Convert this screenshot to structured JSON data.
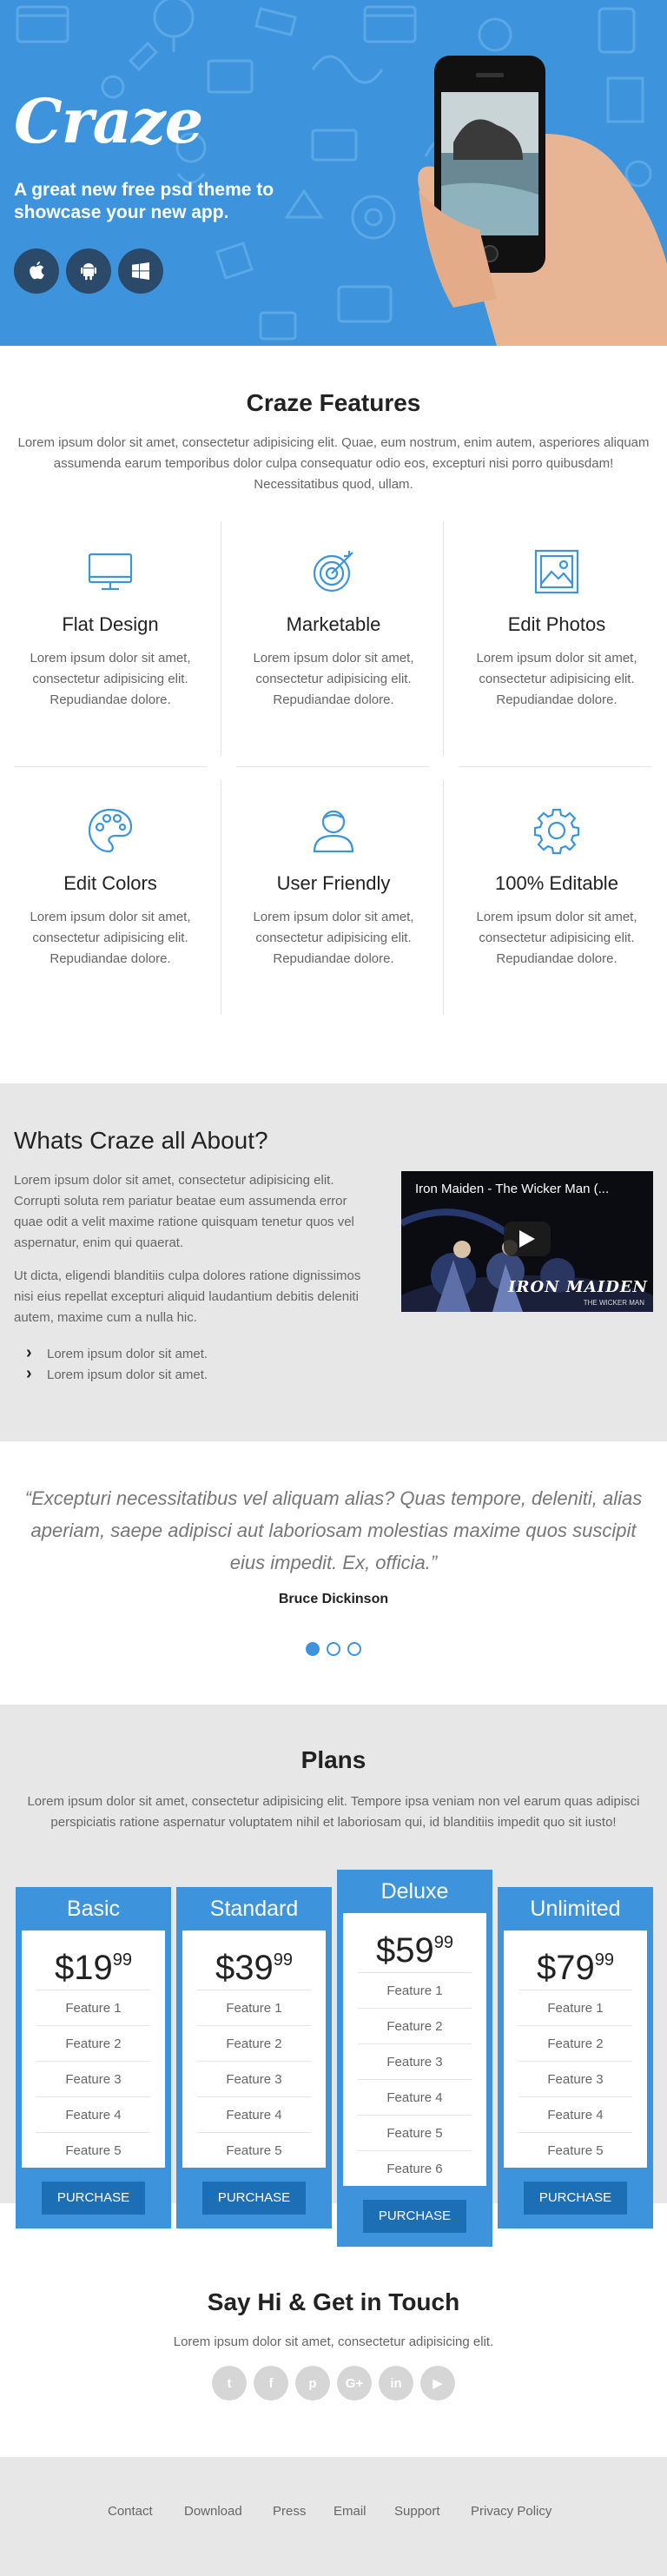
{
  "hero": {
    "logo": "Craze",
    "tagline": "A great new free psd theme to showcase your new app.",
    "store_buttons": [
      {
        "icon": "apple-icon"
      },
      {
        "icon": "android-icon"
      },
      {
        "icon": "windows-icon"
      }
    ]
  },
  "features": {
    "title": "Craze Features",
    "lead": "Lorem ipsum dolor sit amet, consectetur adipisicing elit. Quae, eum nostrum, enim autem, asperiores aliquam assumenda earum temporibus dolor culpa consequatur odio eos, excepturi nisi porro quibusdam! Necessitatibus quod, ullam.",
    "items": [
      {
        "icon": "monitor-icon",
        "title": "Flat Design",
        "text": "Lorem ipsum dolor sit amet, consectetur adipisicing elit. Repudiandae dolore."
      },
      {
        "icon": "target-icon",
        "title": "Marketable",
        "text": "Lorem ipsum dolor sit amet, consectetur adipisicing elit. Repudiandae dolore."
      },
      {
        "icon": "image-icon",
        "title": "Edit Photos",
        "text": "Lorem ipsum dolor sit amet, consectetur adipisicing elit. Repudiandae dolore."
      },
      {
        "icon": "palette-icon",
        "title": "Edit Colors",
        "text": "Lorem ipsum dolor sit amet, consectetur adipisicing elit. Repudiandae dolore."
      },
      {
        "icon": "user-icon",
        "title": "User Friendly",
        "text": "Lorem ipsum dolor sit amet, consectetur adipisicing elit. Repudiandae dolore."
      },
      {
        "icon": "gear-icon",
        "title": "100% Editable",
        "text": "Lorem ipsum dolor sit amet, consectetur adipisicing elit. Repudiandae dolore."
      }
    ]
  },
  "about": {
    "title": "Whats Craze all About?",
    "p1": "Lorem ipsum dolor sit amet, consectetur adipisicing elit. Corrupti soluta rem pariatur beatae eum assumenda error quae odit a velit maxime ratione quisquam tenetur quos vel aspernatur, enim qui quaerat.",
    "p2": "Ut dicta, eligendi blanditiis culpa dolores ratione dignissimos nisi eius repellat excepturi aliquid laudantium debitis deleniti autem, maxime cum a nulla hic.",
    "list": [
      "Lorem ipsum dolor sit amet.",
      "Lorem ipsum dolor sit amet."
    ],
    "video_title": "Iron Maiden - The Wicker Man (...",
    "video_logo": "IRON MAIDEN",
    "video_sub": "THE WICKER MAN"
  },
  "testimonial": {
    "quote": "“Excepturi necessitatibus vel aliquam alias? Quas tempore, deleniti, alias aperiam, saepe adipisci aut laboriosam molestias maxime quos suscipit eius impedit. Ex, officia.”",
    "author": "Bruce Dickinson",
    "active_dot": 0
  },
  "plans": {
    "title": "Plans",
    "lead": "Lorem ipsum dolor sit amet, consectetur adipisicing elit. Tempore ipsa veniam non vel earum quas adipisci perspiciatis ratione aspernatur voluptatem nihil et laboriosam qui, id blanditiis impedit quo sit iusto!",
    "items": [
      {
        "name": "Basic",
        "dollars": "$19",
        "cents": "99",
        "features": [
          "Feature 1",
          "Feature 2",
          "Feature 3",
          "Feature 4",
          "Feature 5"
        ],
        "button": "PURCHASE"
      },
      {
        "name": "Standard",
        "dollars": "$39",
        "cents": "99",
        "features": [
          "Feature 1",
          "Feature 2",
          "Feature 3",
          "Feature 4",
          "Feature 5"
        ],
        "button": "PURCHASE"
      },
      {
        "name": "Deluxe",
        "dollars": "$59",
        "cents": "99",
        "features": [
          "Feature 1",
          "Feature 2",
          "Feature 3",
          "Feature 4",
          "Feature 5",
          "Feature 6"
        ],
        "button": "PURCHASE"
      },
      {
        "name": "Unlimited",
        "dollars": "$79",
        "cents": "99",
        "features": [
          "Feature 1",
          "Feature 2",
          "Feature 3",
          "Feature 4",
          "Feature 5"
        ],
        "button": "PURCHASE"
      }
    ]
  },
  "contact": {
    "title": "Say Hi & Get in Touch",
    "lead": "Lorem ipsum dolor sit amet, consectetur adipisicing elit.",
    "social": [
      {
        "icon": "twitter-icon",
        "glyph": "t"
      },
      {
        "icon": "facebook-icon",
        "glyph": "f"
      },
      {
        "icon": "pinterest-icon",
        "glyph": "p"
      },
      {
        "icon": "google-plus-icon",
        "glyph": "G+"
      },
      {
        "icon": "linkedin-icon",
        "glyph": "in"
      },
      {
        "icon": "youtube-icon",
        "glyph": "▶"
      }
    ]
  },
  "footer": {
    "links": [
      "Contact",
      "Download",
      "Press",
      "Email",
      "Support",
      "Privacy Policy"
    ]
  },
  "colors": {
    "primary": "#3d94dc",
    "dark_button": "#1c6fb5",
    "section_gray": "#e7e7e7"
  }
}
